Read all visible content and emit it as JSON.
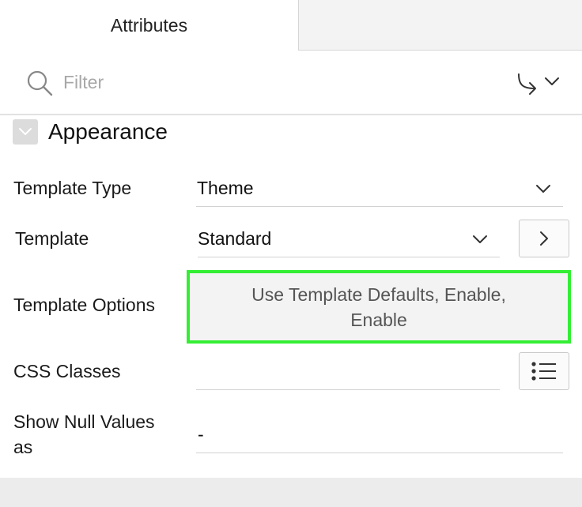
{
  "tabs": {
    "active_label": "Attributes",
    "inactive_label": ""
  },
  "filter": {
    "placeholder": "Filter",
    "value": ""
  },
  "section": {
    "title": "Appearance",
    "expanded": true
  },
  "fields": {
    "template_type": {
      "label": "Template Type",
      "value": "Theme"
    },
    "template": {
      "label": "Template",
      "value": "Standard"
    },
    "template_options": {
      "label": "Template Options",
      "value": "Use Template Defaults, Enable, Enable"
    },
    "css_classes": {
      "label": "CSS Classes",
      "value": ""
    },
    "show_null_values_as": {
      "label_line1": "Show Null Values",
      "label_line2": "as",
      "value": "-"
    }
  },
  "icons": {
    "search": "search-icon",
    "goto": "goto-arrow-icon",
    "dropdown": "chevron-down-icon",
    "forward": "chevron-right-icon",
    "list": "list-icon"
  },
  "colors": {
    "highlight_border": "#33ee33",
    "tab_inactive_bg": "#f3f3f3",
    "toggle_bg": "#dcdcdc"
  }
}
